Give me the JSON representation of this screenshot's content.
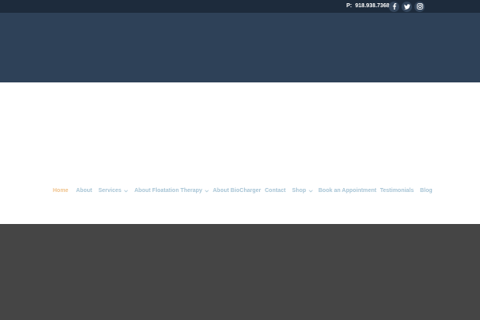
{
  "topbar": {
    "phone_prefix": "P:",
    "phone_number": "918.938.7368",
    "social": [
      {
        "icon": "facebook-icon"
      },
      {
        "icon": "twitter-icon"
      },
      {
        "icon": "instagram-icon"
      }
    ]
  },
  "nav": {
    "items": [
      {
        "label": "Home",
        "active": true
      },
      {
        "label": "About"
      },
      {
        "label": "Services",
        "has_dropdown": true
      },
      {
        "label": "About Floatation Therapy",
        "has_dropdown": true
      },
      {
        "label": "About BioCharger"
      },
      {
        "label": "Contact"
      },
      {
        "label": "Shop",
        "has_dropdown": true
      },
      {
        "label": "Book an Appointment"
      },
      {
        "label": "Testimonials"
      },
      {
        "label": "Blog"
      }
    ]
  },
  "colors": {
    "topbar": "#1d2b3c",
    "hero": "#2e4158",
    "nav_text": "#a8c5d6",
    "nav_active": "#f0c38c",
    "footer": "#454545"
  }
}
